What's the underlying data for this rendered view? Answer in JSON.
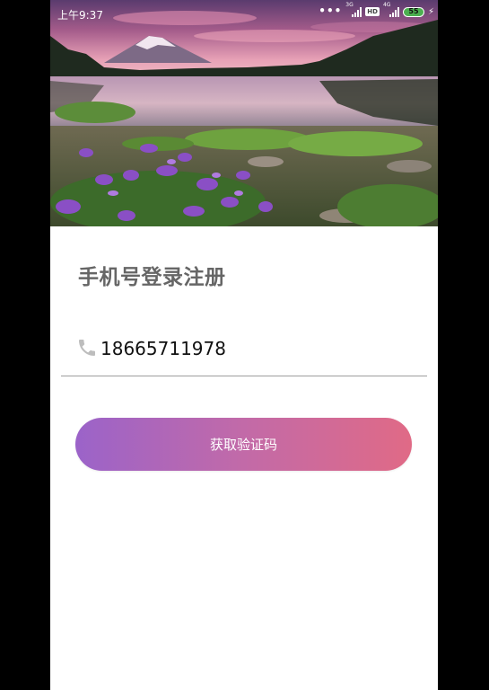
{
  "status_bar": {
    "time": "上午9:37",
    "net1": "3G",
    "net2": "4G",
    "hd": "HD",
    "battery": "55"
  },
  "hero": {
    "icon": "landscape-lake-mountain-image"
  },
  "login": {
    "title": "手机号登录注册",
    "phone_icon": "phone-icon",
    "phone_value": "18665711978",
    "get_code_label": "获取验证码"
  },
  "colors": {
    "button_start": "#9b63c9",
    "button_end": "#e06a86",
    "title": "#666666"
  }
}
